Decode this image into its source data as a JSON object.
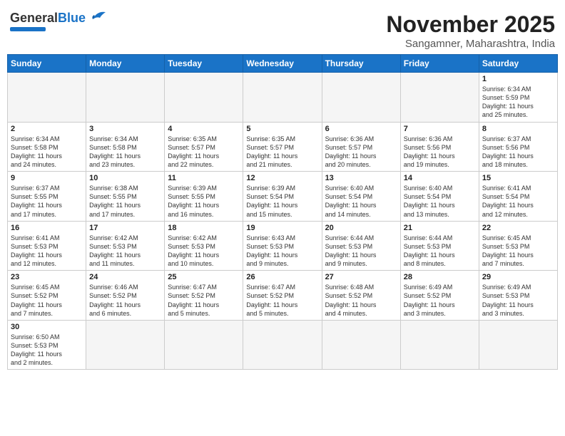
{
  "header": {
    "logo_line1": "General",
    "logo_line2": "Blue",
    "month": "November 2025",
    "location": "Sangamner, Maharashtra, India"
  },
  "weekdays": [
    "Sunday",
    "Monday",
    "Tuesday",
    "Wednesday",
    "Thursday",
    "Friday",
    "Saturday"
  ],
  "weeks": [
    [
      {
        "day": "",
        "info": ""
      },
      {
        "day": "",
        "info": ""
      },
      {
        "day": "",
        "info": ""
      },
      {
        "day": "",
        "info": ""
      },
      {
        "day": "",
        "info": ""
      },
      {
        "day": "",
        "info": ""
      },
      {
        "day": "1",
        "info": "Sunrise: 6:34 AM\nSunset: 5:59 PM\nDaylight: 11 hours\nand 25 minutes."
      }
    ],
    [
      {
        "day": "2",
        "info": "Sunrise: 6:34 AM\nSunset: 5:58 PM\nDaylight: 11 hours\nand 24 minutes."
      },
      {
        "day": "3",
        "info": "Sunrise: 6:34 AM\nSunset: 5:58 PM\nDaylight: 11 hours\nand 23 minutes."
      },
      {
        "day": "4",
        "info": "Sunrise: 6:35 AM\nSunset: 5:57 PM\nDaylight: 11 hours\nand 22 minutes."
      },
      {
        "day": "5",
        "info": "Sunrise: 6:35 AM\nSunset: 5:57 PM\nDaylight: 11 hours\nand 21 minutes."
      },
      {
        "day": "6",
        "info": "Sunrise: 6:36 AM\nSunset: 5:57 PM\nDaylight: 11 hours\nand 20 minutes."
      },
      {
        "day": "7",
        "info": "Sunrise: 6:36 AM\nSunset: 5:56 PM\nDaylight: 11 hours\nand 19 minutes."
      },
      {
        "day": "8",
        "info": "Sunrise: 6:37 AM\nSunset: 5:56 PM\nDaylight: 11 hours\nand 18 minutes."
      }
    ],
    [
      {
        "day": "9",
        "info": "Sunrise: 6:37 AM\nSunset: 5:55 PM\nDaylight: 11 hours\nand 17 minutes."
      },
      {
        "day": "10",
        "info": "Sunrise: 6:38 AM\nSunset: 5:55 PM\nDaylight: 11 hours\nand 17 minutes."
      },
      {
        "day": "11",
        "info": "Sunrise: 6:39 AM\nSunset: 5:55 PM\nDaylight: 11 hours\nand 16 minutes."
      },
      {
        "day": "12",
        "info": "Sunrise: 6:39 AM\nSunset: 5:54 PM\nDaylight: 11 hours\nand 15 minutes."
      },
      {
        "day": "13",
        "info": "Sunrise: 6:40 AM\nSunset: 5:54 PM\nDaylight: 11 hours\nand 14 minutes."
      },
      {
        "day": "14",
        "info": "Sunrise: 6:40 AM\nSunset: 5:54 PM\nDaylight: 11 hours\nand 13 minutes."
      },
      {
        "day": "15",
        "info": "Sunrise: 6:41 AM\nSunset: 5:54 PM\nDaylight: 11 hours\nand 12 minutes."
      }
    ],
    [
      {
        "day": "16",
        "info": "Sunrise: 6:41 AM\nSunset: 5:53 PM\nDaylight: 11 hours\nand 12 minutes."
      },
      {
        "day": "17",
        "info": "Sunrise: 6:42 AM\nSunset: 5:53 PM\nDaylight: 11 hours\nand 11 minutes."
      },
      {
        "day": "18",
        "info": "Sunrise: 6:42 AM\nSunset: 5:53 PM\nDaylight: 11 hours\nand 10 minutes."
      },
      {
        "day": "19",
        "info": "Sunrise: 6:43 AM\nSunset: 5:53 PM\nDaylight: 11 hours\nand 9 minutes."
      },
      {
        "day": "20",
        "info": "Sunrise: 6:44 AM\nSunset: 5:53 PM\nDaylight: 11 hours\nand 9 minutes."
      },
      {
        "day": "21",
        "info": "Sunrise: 6:44 AM\nSunset: 5:53 PM\nDaylight: 11 hours\nand 8 minutes."
      },
      {
        "day": "22",
        "info": "Sunrise: 6:45 AM\nSunset: 5:53 PM\nDaylight: 11 hours\nand 7 minutes."
      }
    ],
    [
      {
        "day": "23",
        "info": "Sunrise: 6:45 AM\nSunset: 5:52 PM\nDaylight: 11 hours\nand 7 minutes."
      },
      {
        "day": "24",
        "info": "Sunrise: 6:46 AM\nSunset: 5:52 PM\nDaylight: 11 hours\nand 6 minutes."
      },
      {
        "day": "25",
        "info": "Sunrise: 6:47 AM\nSunset: 5:52 PM\nDaylight: 11 hours\nand 5 minutes."
      },
      {
        "day": "26",
        "info": "Sunrise: 6:47 AM\nSunset: 5:52 PM\nDaylight: 11 hours\nand 5 minutes."
      },
      {
        "day": "27",
        "info": "Sunrise: 6:48 AM\nSunset: 5:52 PM\nDaylight: 11 hours\nand 4 minutes."
      },
      {
        "day": "28",
        "info": "Sunrise: 6:49 AM\nSunset: 5:52 PM\nDaylight: 11 hours\nand 3 minutes."
      },
      {
        "day": "29",
        "info": "Sunrise: 6:49 AM\nSunset: 5:53 PM\nDaylight: 11 hours\nand 3 minutes."
      }
    ],
    [
      {
        "day": "30",
        "info": "Sunrise: 6:50 AM\nSunset: 5:53 PM\nDaylight: 11 hours\nand 2 minutes."
      },
      {
        "day": "",
        "info": ""
      },
      {
        "day": "",
        "info": ""
      },
      {
        "day": "",
        "info": ""
      },
      {
        "day": "",
        "info": ""
      },
      {
        "day": "",
        "info": ""
      },
      {
        "day": "",
        "info": ""
      }
    ]
  ]
}
